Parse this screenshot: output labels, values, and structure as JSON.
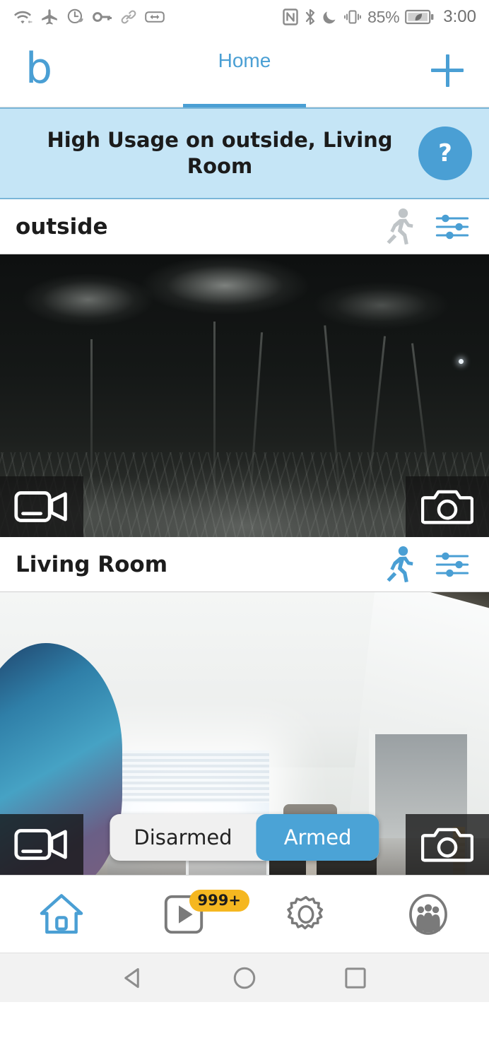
{
  "status_bar": {
    "left_icons": [
      "wifi-icon",
      "airplane-mode-icon",
      "power-saving-icon",
      "vpn-key-icon",
      "link-icon",
      "card-icon"
    ],
    "right_icons": [
      "nfc-icon",
      "bluetooth-icon",
      "do-not-disturb-icon",
      "vibrate-icon"
    ],
    "battery_percent": "85%",
    "battery_icon": "battery-eco-icon",
    "clock": "3:00"
  },
  "app_bar": {
    "logo": "b",
    "tab_label": "Home",
    "add_button": "add-icon"
  },
  "banner": {
    "message": "High Usage on outside, Living Room",
    "help_label": "?",
    "background": "#c5e5f6",
    "accent": "#4a9fd4"
  },
  "cameras": [
    {
      "name": "outside",
      "motion_icon": "motion-person-icon",
      "motion_active": false,
      "settings_icon": "sliders-icon",
      "record_button": "video-record-icon",
      "snapshot_button": "photo-camera-icon",
      "scene": "night-vision-outdoor"
    },
    {
      "name": "Living Room",
      "motion_icon": "motion-person-icon",
      "motion_active": true,
      "settings_icon": "sliders-icon",
      "record_button": "video-record-icon",
      "snapshot_button": "photo-camera-icon",
      "scene": "indoor-daylight"
    }
  ],
  "arm_toggle": {
    "disarmed_label": "Disarmed",
    "armed_label": "Armed",
    "selected": "Armed",
    "active_color": "#4ba3d6"
  },
  "bottom_nav": {
    "items": [
      {
        "name": "home",
        "icon": "home-icon",
        "active": true
      },
      {
        "name": "clips",
        "icon": "play-clip-icon",
        "active": false,
        "badge": "999+"
      },
      {
        "name": "settings",
        "icon": "gear-icon",
        "active": false
      },
      {
        "name": "account",
        "icon": "people-group-icon",
        "active": false
      }
    ],
    "badge_color": "#f5b720",
    "active_color": "#4a9fd4"
  },
  "android_nav": {
    "back": "back-triangle-icon",
    "home": "home-circle-icon",
    "recents": "recents-square-icon"
  }
}
